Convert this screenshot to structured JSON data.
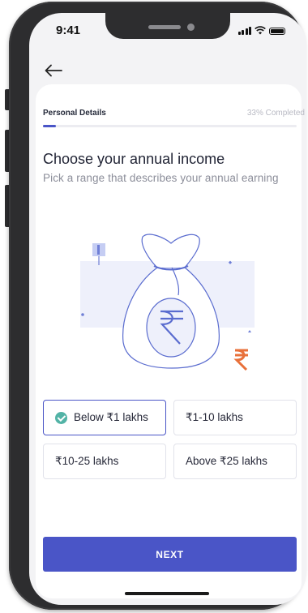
{
  "status_bar": {
    "time": "9:41"
  },
  "header": {
    "back_icon": "arrow-left-icon"
  },
  "progress": {
    "label": "Personal Details",
    "completed_text": "33% Completed",
    "fraction": 0.05
  },
  "heading": {
    "title": "Choose your annual income",
    "subtitle": "Pick a range that describes your annual earning"
  },
  "income_options": [
    {
      "label": "Below ₹1 lakhs",
      "selected": true
    },
    {
      "label": "₹1-10 lakhs",
      "selected": false
    },
    {
      "label": "₹10-25 lakhs",
      "selected": false
    },
    {
      "label": "Above ₹25 lakhs",
      "selected": false
    }
  ],
  "actions": {
    "next_label": "NEXT"
  },
  "colors": {
    "accent": "#4a55c7",
    "check": "#52b3a6",
    "rupee_orange": "#e8703a",
    "muted_text": "#8b8d99"
  }
}
